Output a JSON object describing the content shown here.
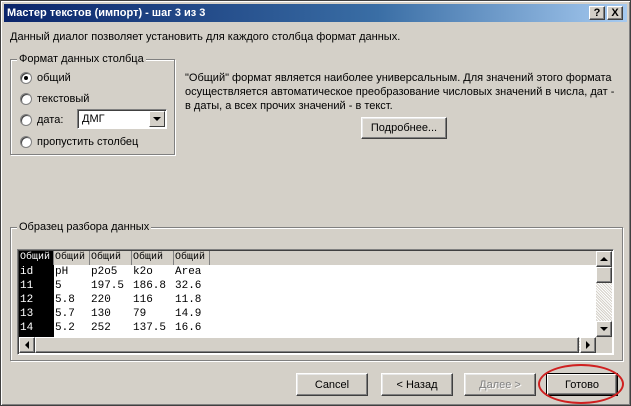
{
  "window": {
    "title": "Мастер текстов (импорт) - шаг 3 из 3",
    "help_btn": "?",
    "close_btn": "X"
  },
  "description": "Данный диалог позволяет установить для каждого столбца формат данных.",
  "format_group": {
    "legend": "Формат данных столбца",
    "options": [
      {
        "label": "общий",
        "checked": true
      },
      {
        "label": "текстовый",
        "checked": false
      },
      {
        "label": "дата:",
        "checked": false
      },
      {
        "label": "пропустить столбец",
        "checked": false
      }
    ],
    "date_combo_value": "ДМГ"
  },
  "info": {
    "line1": "\"Общий\" формат является наиболее универсальным. Для значений этого формата",
    "line2": "осуществляется автоматическое преобразование числовых значений в числа, дат -",
    "line3": "в даты, а всех прочих значений - в текст.",
    "more_button": "Подробнее..."
  },
  "preview": {
    "legend": "Образец разбора данных",
    "headers": [
      "Общий",
      "Общий",
      "Общий",
      "Общий",
      "Общий"
    ],
    "rows": [
      [
        "id",
        "pH",
        "p2o5",
        "k2o",
        "Area"
      ],
      [
        "11",
        "5",
        "197.5",
        "186.8",
        "32.6"
      ],
      [
        "12",
        "5.8",
        "220",
        "116",
        "11.8"
      ],
      [
        "13",
        "5.7",
        "130",
        "79",
        "14.9"
      ],
      [
        "14",
        "5.2",
        "252",
        "137.5",
        "16.6"
      ]
    ]
  },
  "buttons": {
    "cancel": "Cancel",
    "back": "< Назад",
    "next": "Далее >",
    "finish": "Готово"
  },
  "colors": {
    "title_start": "#0a246a",
    "title_end": "#a6caf0",
    "face": "#d4d0c8",
    "highlight": "#d02020"
  }
}
